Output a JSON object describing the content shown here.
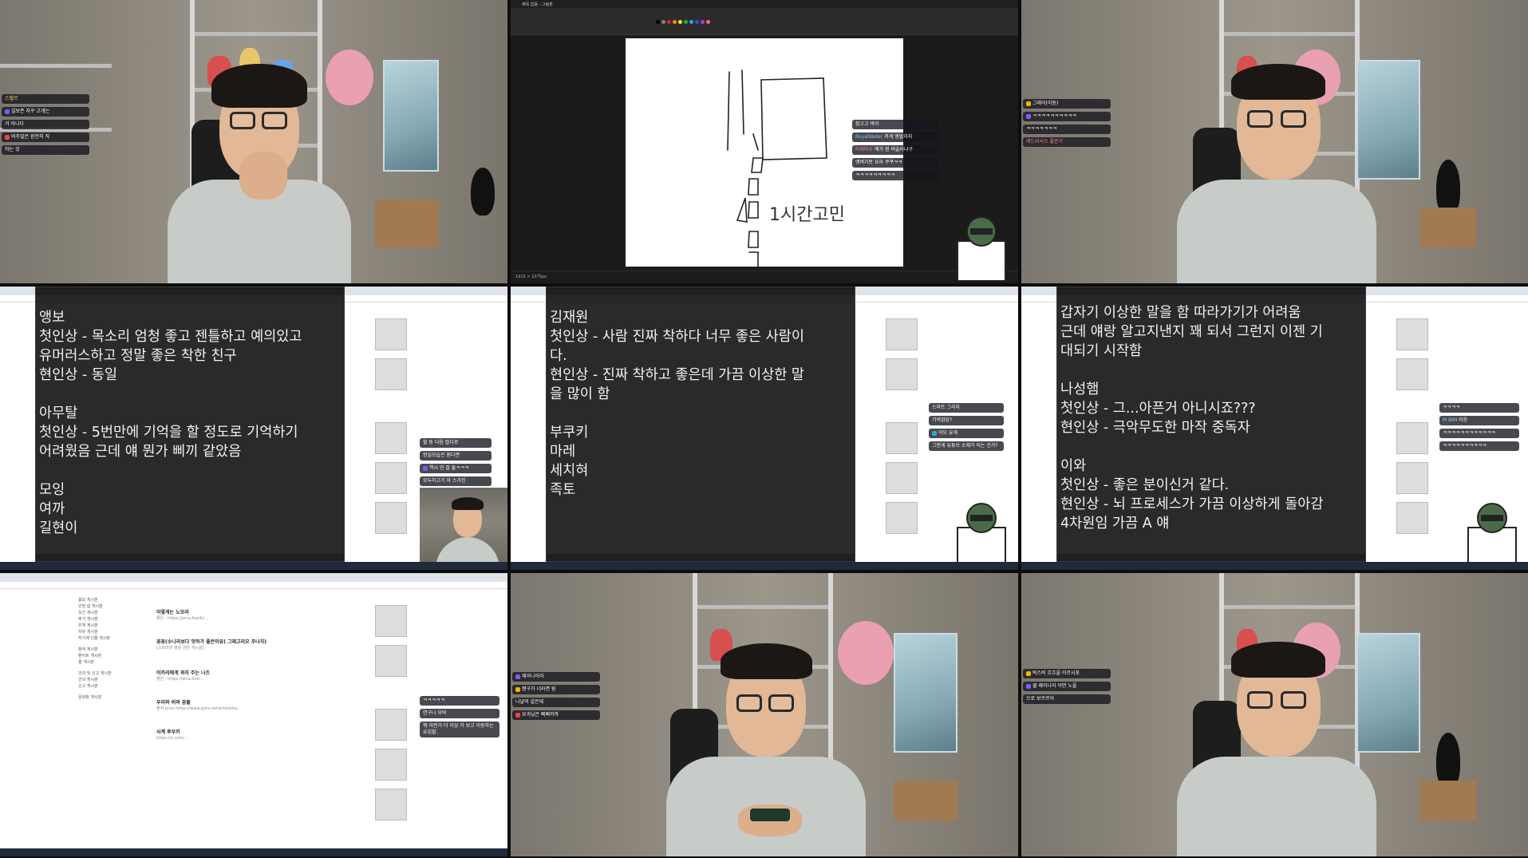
{
  "layout": {
    "columns": 3,
    "rows": 3
  },
  "cells": {
    "cam1": {
      "chat": [
        {
          "nick": "스텔르",
          "text": ""
        },
        {
          "nick": "",
          "text": "길보존 자꾸 고개는"
        },
        {
          "nick": "",
          "text": "거 아니다"
        },
        {
          "nick": "",
          "text": "비주얼은 완전히 직"
        },
        {
          "nick": "",
          "text": "하는 것"
        }
      ]
    },
    "paint": {
      "app_title": "제목 없음 - 그림판",
      "canvas_label": "1시간고민",
      "status_left": "1915 × 1075px",
      "chat": [
        {
          "nick": "",
          "text": "참고고 바아"
        },
        {
          "nick": "RoyalWater",
          "text": "저게 앵벌이지"
        },
        {
          "nick": "티라미수",
          "text": "얘가 뭔 버슬이냐구"
        },
        {
          "nick": "",
          "text": "앵버가못 요라 쿠쿠ㅋㅋ"
        },
        {
          "nick": "",
          "text": "ㅋㅋㅋㅋㅋㅋㅋㅋㅋ"
        }
      ]
    },
    "cam2": {
      "chat": [
        {
          "nick": "",
          "text": "그래이(이동)"
        },
        {
          "nick": "",
          "text": "ㅋㅋㅋㅋㅋㅋㅋㅋㅋㅋ"
        },
        {
          "nick": "",
          "text": "ㅋㅋㅋㅋㅋㅋㅋ"
        },
        {
          "nick": "",
          "text": "레드라시스 좋은기"
        }
      ]
    },
    "notes1": {
      "lines": [
        "앵보",
        "첫인상 - 목소리 엄청 좋고 젠틀하고 예의있고",
        "유머러스하고 정말 좋은 착한 친구",
        "현인상 - 동일",
        "",
        "아무탈",
        "첫인상 - 5번만에 기억을 할 정도로 기억하기",
        "어려웠음 근데 얘 뭔가 삐끼 같았음",
        "",
        "모잉",
        "여까",
        "길현이"
      ],
      "chat": [
        {
          "nick": "",
          "text": "할 둥 다음 랍다로"
        },
        {
          "nick": "",
          "text": "현실모습은 뭔다면"
        },
        {
          "nick": "",
          "text": "역시 인 잘 돌ㅋㅋㅋ"
        },
        {
          "nick": "",
          "text": "모두하고기 마 스가진"
        }
      ]
    },
    "notes2": {
      "lines": [
        "김재원",
        "첫인상 - 사람 진짜 착하다 너무 좋은 사람이",
        "다.",
        "현인상 - 진짜 착하고 좋은데 가끔 이상한 말",
        "을 많이 함",
        "",
        "부쿠키",
        "마레",
        "세치혀",
        "족토"
      ],
      "chat": [
        {
          "nick": "",
          "text": "스마트 그리자"
        },
        {
          "nick": "",
          "text": "기억검당?"
        },
        {
          "nick": "",
          "text": "이모 유게"
        },
        {
          "nick": "",
          "text": "그런게 유튜브 소재가 되는 건가?"
        }
      ]
    },
    "notes3": {
      "lines": [
        "갑자기 이상한 말을 함 따라가기가 어려움",
        "근데 얘랑 알고지낸지 꽤 되서 그런지 이젠 기",
        "대되기 시작함",
        "",
        "나성햄",
        "첫인상 - 그...아픈거 아니시죠???",
        "현인상 - 극악무도한 마작 중독자",
        "",
        "이와",
        "첫인상 - 좋은 분이신거 같다.",
        "현인상 - 뇌 프로세스가 가끔 이상하게 돌아감",
        "4차원임 가끔 A 얘"
      ],
      "chat": [
        {
          "nick": "",
          "text": "ㅋㅋㅋㅋ"
        },
        {
          "nick": "M BIM",
          "text": "이응"
        },
        {
          "nick": "",
          "text": "ㅋㅋㅋㅋㅋㅋㅋㅋㅋㅋㅋㅋ"
        },
        {
          "nick": "",
          "text": "ㅋㅋㅋㅋㅋㅋㅋㅋㅋㅋ"
        }
      ]
    },
    "forum": {
      "sidebar_items": [
        "홍보 게시판",
        "인방 잡 게시판",
        "웃긴 게시판",
        "후기 게시판",
        "유게 게시판",
        "자유 게시판",
        "자기계 인물 게시판",
        "",
        "창작 게시판",
        "팬아트 게시판",
        "짤 게시판",
        "",
        "건의 및 신고 게시판",
        "건의 게시판",
        "신고 게시판",
        "",
        "문화창 게시판"
      ],
      "posts": [
        {
          "title": "이렇게는 노모리",
          "meta": "좋은 - https://arca.live/b/..."
        },
        {
          "title": "꽁꽁(수나라보다 맛하가 좋은이유( 그래고리오 주나치)",
          "meta": "[스트리머 영상 관련 게시글]"
        },
        {
          "title": "이카리에게 과자 주는 나츠",
          "meta": "좋은 - https://arca.live/..."
        },
        {
          "title": "우리와 비와 꿈똘",
          "meta": "출처 pixiv https://www.pixiv.net/artworks/..."
        },
        {
          "title": "사계 후우키",
          "meta": "https://x.com/..."
        }
      ],
      "chat": [
        {
          "nick": "",
          "text": "ㅋㅋㅋㅋㅋ"
        },
        {
          "nick": "",
          "text": "연구나 부탁"
        },
        {
          "nick": "",
          "text": "뭐 이런거 더 이상 거 보고 이동하는 유입할."
        }
      ]
    },
    "cam3": {
      "chat": [
        {
          "nick": "",
          "text": "제이나이아"
        },
        {
          "nick": "",
          "text": "짱구가 너라면 됨"
        },
        {
          "nick": "",
          "text": "나냘의 겉은데"
        },
        {
          "nick": "",
          "text": "요괴님은 삐삐까까"
        }
      ]
    },
    "cam4": {
      "chat": [
        {
          "nick": "",
          "text": "빅스비 흐흐을 이르시포"
        },
        {
          "nick": "",
          "text": "쿨 제이나이 어떤 노을"
        },
        {
          "nick": "",
          "text": "으로 보르르어"
        }
      ]
    }
  },
  "colors": {
    "notes_bg": "#2a2a2a",
    "notes_text": "#f2f2f2",
    "chat_bg": "#14141e",
    "nick": "#f4d35e"
  }
}
